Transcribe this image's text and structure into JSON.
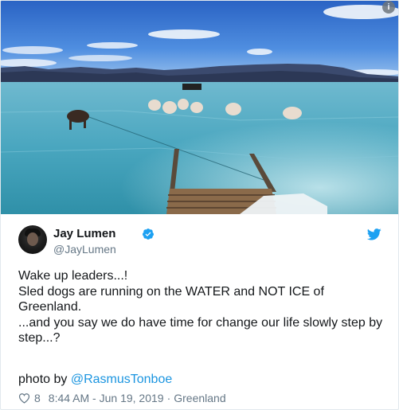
{
  "tweet": {
    "display_name": "Jay Lumen",
    "handle": "@JayLumen",
    "lines": [
      "Wake up leaders...!",
      "Sled dogs are running on the WATER and NOT ICE of",
      "Greenland.",
      "...and you say we do have time for change our life slowly step by",
      "step...?"
    ],
    "credit_prefix": "photo by ",
    "credit_mention": "@RasmusTonboe",
    "likes": "8",
    "timestamp": "8:44 AM - Jun 19, 2019",
    "separator": "·",
    "location": "Greenland",
    "info_glyph": "i"
  },
  "icons": {
    "verified": "verified-badge-icon",
    "bird": "twitter-bird-icon",
    "heart": "heart-icon",
    "info": "info-icon"
  },
  "colors": {
    "brand_blue": "#1da1f2",
    "mention_blue": "#1b95e0",
    "meta_gray": "#657786",
    "text": "#14171a"
  }
}
